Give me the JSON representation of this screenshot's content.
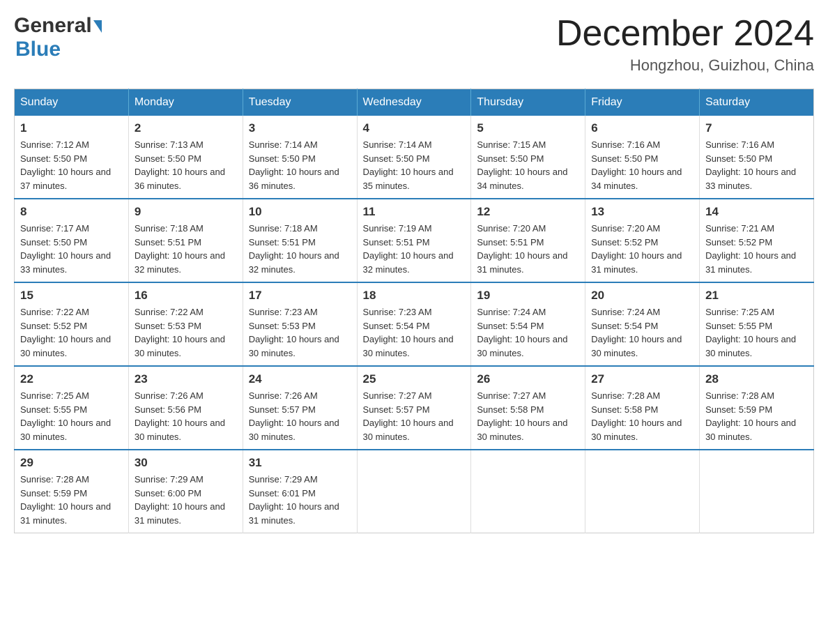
{
  "logo": {
    "general": "General",
    "blue": "Blue"
  },
  "title": "December 2024",
  "subtitle": "Hongzhou, Guizhou, China",
  "headers": [
    "Sunday",
    "Monday",
    "Tuesday",
    "Wednesday",
    "Thursday",
    "Friday",
    "Saturday"
  ],
  "weeks": [
    [
      {
        "day": "1",
        "sunrise": "Sunrise: 7:12 AM",
        "sunset": "Sunset: 5:50 PM",
        "daylight": "Daylight: 10 hours and 37 minutes."
      },
      {
        "day": "2",
        "sunrise": "Sunrise: 7:13 AM",
        "sunset": "Sunset: 5:50 PM",
        "daylight": "Daylight: 10 hours and 36 minutes."
      },
      {
        "day": "3",
        "sunrise": "Sunrise: 7:14 AM",
        "sunset": "Sunset: 5:50 PM",
        "daylight": "Daylight: 10 hours and 36 minutes."
      },
      {
        "day": "4",
        "sunrise": "Sunrise: 7:14 AM",
        "sunset": "Sunset: 5:50 PM",
        "daylight": "Daylight: 10 hours and 35 minutes."
      },
      {
        "day": "5",
        "sunrise": "Sunrise: 7:15 AM",
        "sunset": "Sunset: 5:50 PM",
        "daylight": "Daylight: 10 hours and 34 minutes."
      },
      {
        "day": "6",
        "sunrise": "Sunrise: 7:16 AM",
        "sunset": "Sunset: 5:50 PM",
        "daylight": "Daylight: 10 hours and 34 minutes."
      },
      {
        "day": "7",
        "sunrise": "Sunrise: 7:16 AM",
        "sunset": "Sunset: 5:50 PM",
        "daylight": "Daylight: 10 hours and 33 minutes."
      }
    ],
    [
      {
        "day": "8",
        "sunrise": "Sunrise: 7:17 AM",
        "sunset": "Sunset: 5:50 PM",
        "daylight": "Daylight: 10 hours and 33 minutes."
      },
      {
        "day": "9",
        "sunrise": "Sunrise: 7:18 AM",
        "sunset": "Sunset: 5:51 PM",
        "daylight": "Daylight: 10 hours and 32 minutes."
      },
      {
        "day": "10",
        "sunrise": "Sunrise: 7:18 AM",
        "sunset": "Sunset: 5:51 PM",
        "daylight": "Daylight: 10 hours and 32 minutes."
      },
      {
        "day": "11",
        "sunrise": "Sunrise: 7:19 AM",
        "sunset": "Sunset: 5:51 PM",
        "daylight": "Daylight: 10 hours and 32 minutes."
      },
      {
        "day": "12",
        "sunrise": "Sunrise: 7:20 AM",
        "sunset": "Sunset: 5:51 PM",
        "daylight": "Daylight: 10 hours and 31 minutes."
      },
      {
        "day": "13",
        "sunrise": "Sunrise: 7:20 AM",
        "sunset": "Sunset: 5:52 PM",
        "daylight": "Daylight: 10 hours and 31 minutes."
      },
      {
        "day": "14",
        "sunrise": "Sunrise: 7:21 AM",
        "sunset": "Sunset: 5:52 PM",
        "daylight": "Daylight: 10 hours and 31 minutes."
      }
    ],
    [
      {
        "day": "15",
        "sunrise": "Sunrise: 7:22 AM",
        "sunset": "Sunset: 5:52 PM",
        "daylight": "Daylight: 10 hours and 30 minutes."
      },
      {
        "day": "16",
        "sunrise": "Sunrise: 7:22 AM",
        "sunset": "Sunset: 5:53 PM",
        "daylight": "Daylight: 10 hours and 30 minutes."
      },
      {
        "day": "17",
        "sunrise": "Sunrise: 7:23 AM",
        "sunset": "Sunset: 5:53 PM",
        "daylight": "Daylight: 10 hours and 30 minutes."
      },
      {
        "day": "18",
        "sunrise": "Sunrise: 7:23 AM",
        "sunset": "Sunset: 5:54 PM",
        "daylight": "Daylight: 10 hours and 30 minutes."
      },
      {
        "day": "19",
        "sunrise": "Sunrise: 7:24 AM",
        "sunset": "Sunset: 5:54 PM",
        "daylight": "Daylight: 10 hours and 30 minutes."
      },
      {
        "day": "20",
        "sunrise": "Sunrise: 7:24 AM",
        "sunset": "Sunset: 5:54 PM",
        "daylight": "Daylight: 10 hours and 30 minutes."
      },
      {
        "day": "21",
        "sunrise": "Sunrise: 7:25 AM",
        "sunset": "Sunset: 5:55 PM",
        "daylight": "Daylight: 10 hours and 30 minutes."
      }
    ],
    [
      {
        "day": "22",
        "sunrise": "Sunrise: 7:25 AM",
        "sunset": "Sunset: 5:55 PM",
        "daylight": "Daylight: 10 hours and 30 minutes."
      },
      {
        "day": "23",
        "sunrise": "Sunrise: 7:26 AM",
        "sunset": "Sunset: 5:56 PM",
        "daylight": "Daylight: 10 hours and 30 minutes."
      },
      {
        "day": "24",
        "sunrise": "Sunrise: 7:26 AM",
        "sunset": "Sunset: 5:57 PM",
        "daylight": "Daylight: 10 hours and 30 minutes."
      },
      {
        "day": "25",
        "sunrise": "Sunrise: 7:27 AM",
        "sunset": "Sunset: 5:57 PM",
        "daylight": "Daylight: 10 hours and 30 minutes."
      },
      {
        "day": "26",
        "sunrise": "Sunrise: 7:27 AM",
        "sunset": "Sunset: 5:58 PM",
        "daylight": "Daylight: 10 hours and 30 minutes."
      },
      {
        "day": "27",
        "sunrise": "Sunrise: 7:28 AM",
        "sunset": "Sunset: 5:58 PM",
        "daylight": "Daylight: 10 hours and 30 minutes."
      },
      {
        "day": "28",
        "sunrise": "Sunrise: 7:28 AM",
        "sunset": "Sunset: 5:59 PM",
        "daylight": "Daylight: 10 hours and 30 minutes."
      }
    ],
    [
      {
        "day": "29",
        "sunrise": "Sunrise: 7:28 AM",
        "sunset": "Sunset: 5:59 PM",
        "daylight": "Daylight: 10 hours and 31 minutes."
      },
      {
        "day": "30",
        "sunrise": "Sunrise: 7:29 AM",
        "sunset": "Sunset: 6:00 PM",
        "daylight": "Daylight: 10 hours and 31 minutes."
      },
      {
        "day": "31",
        "sunrise": "Sunrise: 7:29 AM",
        "sunset": "Sunset: 6:01 PM",
        "daylight": "Daylight: 10 hours and 31 minutes."
      },
      null,
      null,
      null,
      null
    ]
  ]
}
